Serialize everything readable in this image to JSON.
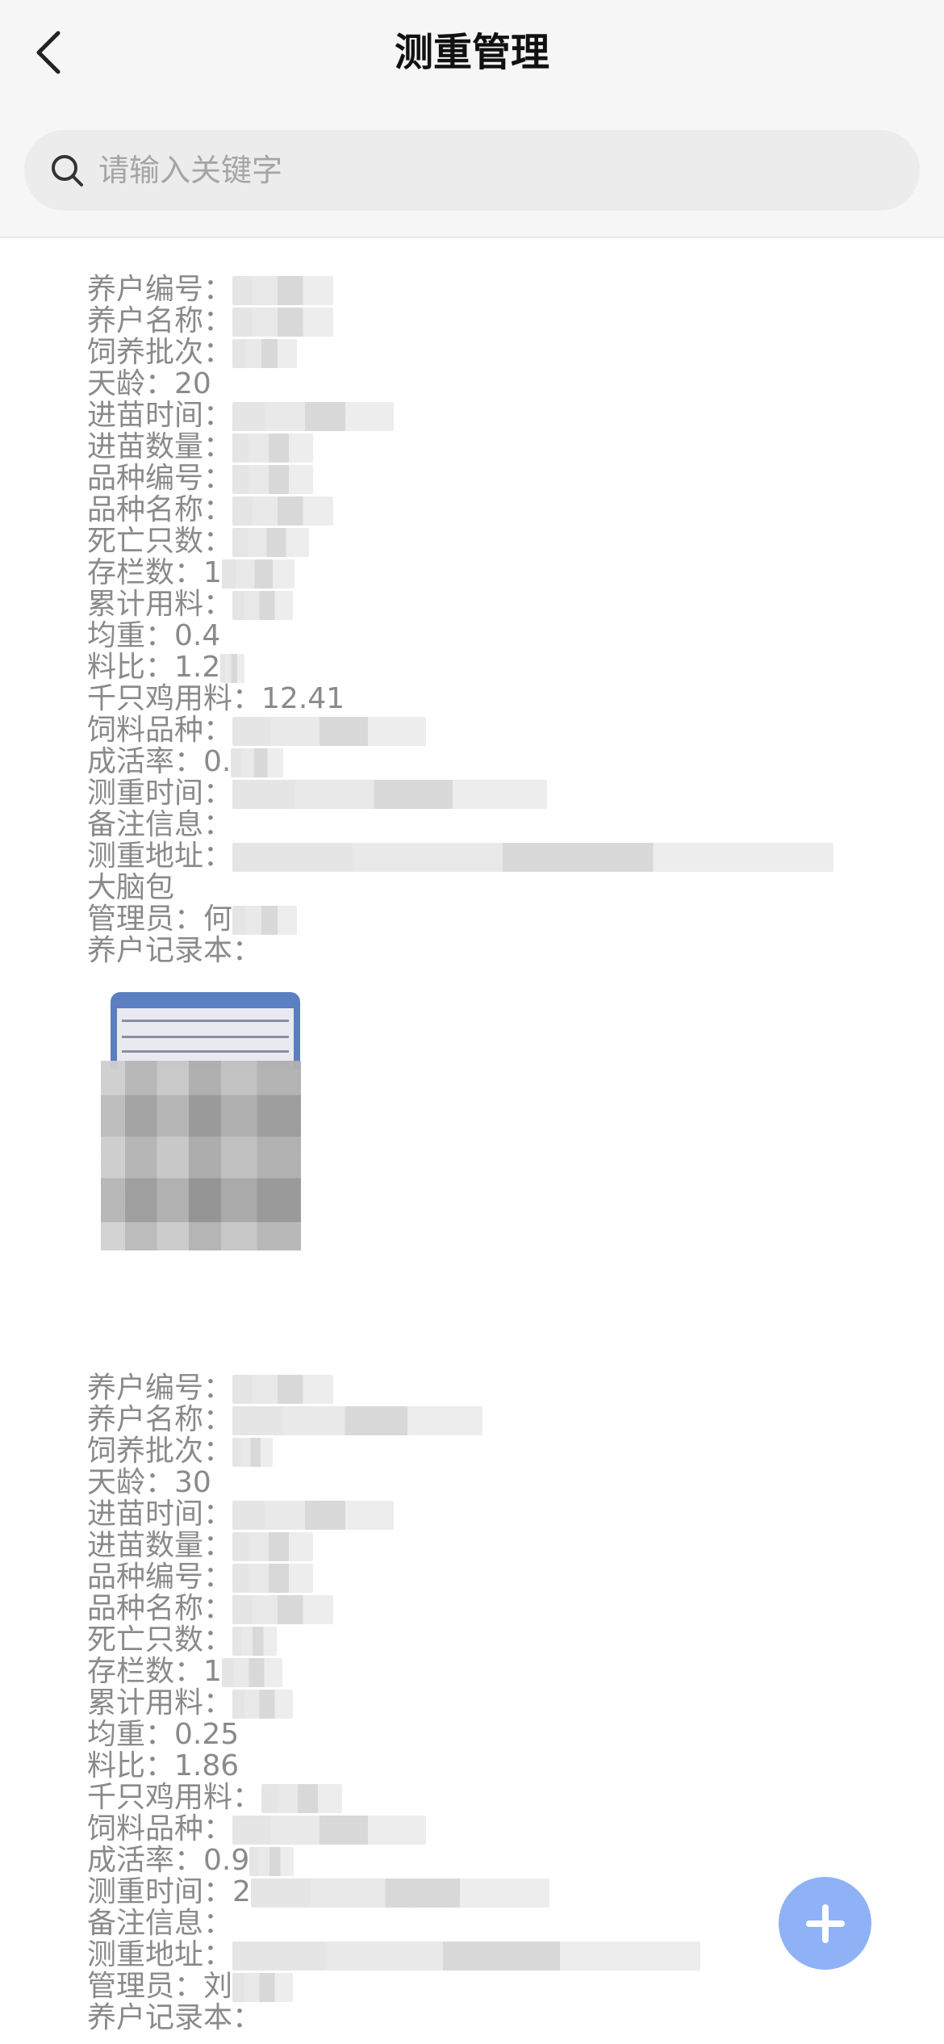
{
  "header": {
    "title": "测重管理",
    "back_icon": "chevron-left-icon"
  },
  "search": {
    "placeholder": "请输入关键字",
    "value": ""
  },
  "records": [
    {
      "farm_no_label": "养户编号：",
      "farm_name_label": "养户名称：",
      "batch_label": "饲养批次：",
      "age_label": "天龄：",
      "age_value": "20",
      "intake_time_label": "进苗时间：",
      "intake_qty_label": "进苗数量：",
      "breed_no_label": "品种编号：",
      "breed_name_label": "品种名称：",
      "death_label": "死亡只数：",
      "stock_label": "存栏数：",
      "stock_prefix": "1",
      "feed_total_label": "累计用料：",
      "avg_weight_label": "均重：",
      "avg_weight_value": "0.4",
      "feed_ratio_label": "料比：",
      "feed_ratio_value": "1.2",
      "per_thousand_label": "千只鸡用料：",
      "per_thousand_value": "12.41",
      "feed_variety_label": "饲料品种：",
      "survival_label": "成活率：",
      "survival_prefix": "0.",
      "weigh_time_label": "测重时间：",
      "remark_label": "备注信息：",
      "address_label": "测重地址：",
      "address_tail": "大脑包",
      "admin_label": "管理员：",
      "admin_prefix": "何",
      "record_book_label": "养户记录本："
    },
    {
      "farm_no_label": "养户编号：",
      "farm_name_label": "养户名称：",
      "batch_label": "饲养批次：",
      "age_label": "天龄：",
      "age_value": "30",
      "intake_time_label": "进苗时间：",
      "intake_qty_label": "进苗数量：",
      "breed_no_label": "品种编号：",
      "breed_name_label": "品种名称：",
      "death_label": "死亡只数：",
      "stock_label": "存栏数：",
      "stock_prefix": "1",
      "feed_total_label": "累计用料：",
      "avg_weight_label": "均重：",
      "avg_weight_value": "0.25",
      "feed_ratio_label": "料比：",
      "feed_ratio_value": "1.86",
      "per_thousand_label": "千只鸡用料：",
      "feed_variety_label": "饲料品种：",
      "survival_label": "成活率：",
      "survival_prefix": "0.9",
      "weigh_time_label": "测重时间：",
      "weigh_time_prefix": "2",
      "remark_label": "备注信息：",
      "address_label": "测重地址：",
      "admin_label": "管理员：",
      "admin_prefix": "刘",
      "record_book_label": "养户记录本："
    }
  ],
  "fab": {
    "icon": "plus-icon"
  }
}
